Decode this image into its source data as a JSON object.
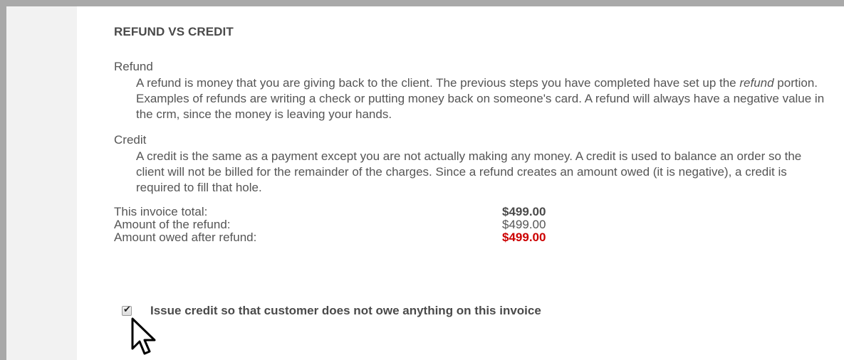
{
  "section": {
    "heading": "REFUND VS CREDIT",
    "refund": {
      "term": "Refund",
      "definition_part1": "A refund is money that you are giving back to the client. The previous steps you have completed have set up the ",
      "definition_emphasis": "refund",
      "definition_part2": " portion. Examples of refunds are writing a check or putting money back on someone's card. A refund will always have a negative value in the crm, since the money is leaving your hands."
    },
    "credit": {
      "term": "Credit",
      "definition": "A credit is the same as a payment except you are not actually making any money. A credit is used to balance an order so the client will not be billed for the remainder of the charges. Since a refund creates an amount owed (it is negative), a credit is required to fill that hole."
    }
  },
  "summary": {
    "invoice_total_label": "This invoice total:",
    "invoice_total_value": "$499.00",
    "refund_amount_label": "Amount of the refund:",
    "refund_amount_value": "$499.00",
    "owed_after_label": "Amount owed after refund:",
    "owed_after_value": "$499.00"
  },
  "issue_credit": {
    "checked": true,
    "label": "Issue credit so that customer does not owe anything on this invoice"
  },
  "colors": {
    "frame": "#a9a9a9",
    "owed_red": "#cc0000"
  }
}
